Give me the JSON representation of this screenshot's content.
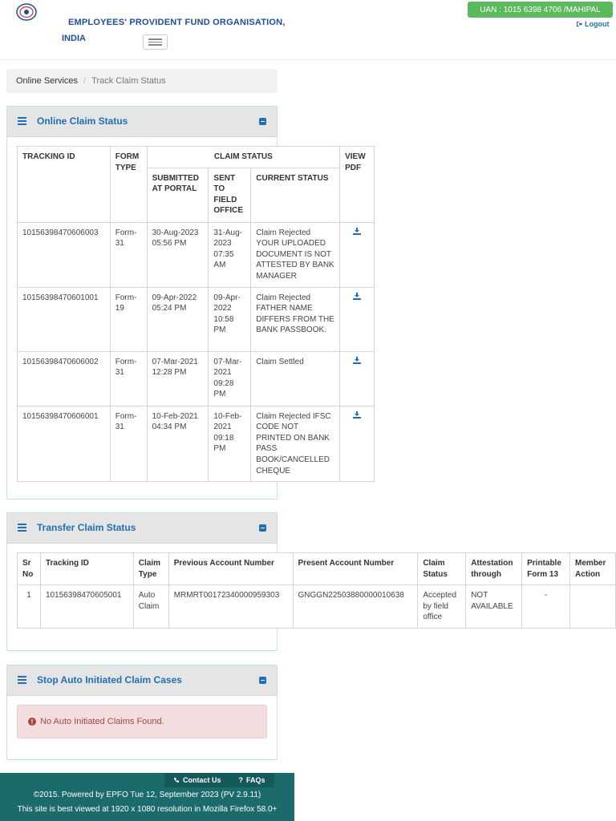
{
  "header": {
    "org_name": "EMPLOYEES' PROVIDENT FUND ORGANISATION,",
    "org_country": "INDIA",
    "uan_badge": "UAN : 1015 6398 4706 /MAHIPAL",
    "logout": "Logout",
    "colors": {
      "brand": "#1f4e93",
      "badge": "#5cb85c"
    }
  },
  "breadcrumb": {
    "items": [
      "Online Services",
      "Track Claim Status"
    ],
    "separator": "/"
  },
  "online_claim": {
    "title": "Online Claim Status",
    "headers": {
      "tracking_id": "TRACKING ID",
      "form_type": "FORM TYPE",
      "claim_status": "CLAIM STATUS",
      "submitted": "SUBMITTED AT PORTAL",
      "sent": "SENT TO FIELD OFFICE",
      "current": "CURRENT STATUS",
      "view_pdf": "VIEW PDF"
    },
    "rows": [
      {
        "tracking_id": "10156398470606003",
        "form": "Form-31",
        "submitted": "30-Aug-2023 05:56 PM",
        "sent": "31-Aug-2023 07:35 AM",
        "status": "Claim Rejected YOUR UPLOADED DOCUMENT IS NOT ATTESTED BY BANK MANAGER"
      },
      {
        "tracking_id": "10156398470601001",
        "form": "Form-19",
        "submitted": "09-Apr-2022 05:24 PM",
        "sent": "09-Apr-2022 10:58 PM",
        "status": "Claim Rejected FATHER NAME DIFFERS FROM THE BANK PASSBOOK."
      },
      {
        "tracking_id": "10156398470606002",
        "form": "Form-31",
        "submitted": "07-Mar-2021 12:28 PM",
        "sent": "07-Mar-2021 09:28 PM",
        "status": "Claim Settled"
      },
      {
        "tracking_id": "10156398470606001",
        "form": "Form-31",
        "submitted": "10-Feb-2021 04:34 PM",
        "sent": "10-Feb-2021 09:18 PM",
        "status": "Claim Rejected IFSC CODE NOT PRINTED ON BANK PASS BOOK/CANCELLED CHEQUE"
      }
    ]
  },
  "transfer_claim": {
    "title": "Transfer Claim Status",
    "headers": [
      "Sr No",
      "Tracking ID",
      "Claim Type",
      "Previous Account Number",
      "Present Account Number",
      "Claim Status",
      "Attestation through",
      "Printable Form 13",
      "Member Action"
    ],
    "rows": [
      {
        "sr": "1",
        "tracking_id": "10156398470605001",
        "claim_type": "Auto Claim",
        "previous": "MRMRT00172340000959303",
        "present": "GNGGN22503880000010638",
        "status": "Accepted by field office",
        "attestation": "NOT AVAILABLE",
        "form13": "-",
        "action": ""
      }
    ]
  },
  "stop_auto": {
    "title": "Stop Auto Initiated Claim Cases",
    "alert": "No Auto Initiated Claims Found."
  },
  "footer": {
    "contact": "Contact Us",
    "faqs": "FAQs",
    "line1": "©2015. Powered by EPFO Tue 12, September 2023 (PV 2.9.11)",
    "line2": "This site is best viewed at 1920 x 1080 resolution in Mozilla Firefox 58.0+"
  }
}
